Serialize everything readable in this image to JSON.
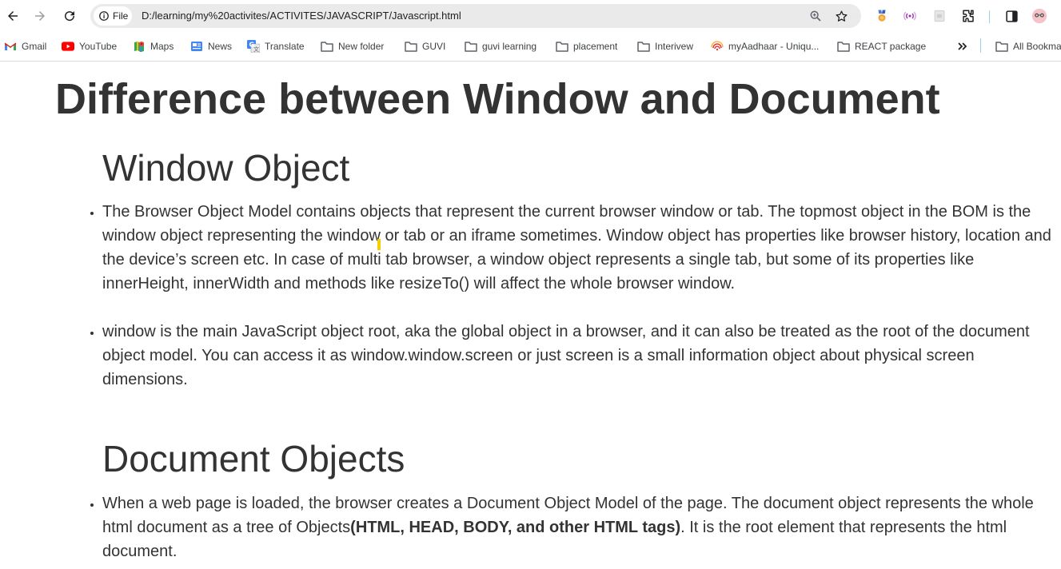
{
  "browser": {
    "site_chip": "File",
    "url": "D:/learning/my%20activites/ACTIVITES/JAVASCRIPT/Javascript.html",
    "icons": {
      "back": "back-arrow-icon",
      "forward": "forward-arrow-icon",
      "reload": "reload-icon",
      "info": "info-icon",
      "zoom": "zoom-icon",
      "bookmark": "star-icon",
      "extensions": "puzzle-icon",
      "side_panel": "side-panel-icon",
      "profile": "profile-avatar-icon"
    }
  },
  "bookmarks": [
    {
      "label": "Gmail",
      "icon": "gmail-icon"
    },
    {
      "label": "YouTube",
      "icon": "youtube-icon"
    },
    {
      "label": "Maps",
      "icon": "maps-icon"
    },
    {
      "label": "News",
      "icon": "news-icon"
    },
    {
      "label": "Translate",
      "icon": "translate-icon"
    },
    {
      "label": "New folder",
      "icon": "folder-icon"
    },
    {
      "label": "GUVI",
      "icon": "folder-icon"
    },
    {
      "label": "guvi learning",
      "icon": "folder-icon"
    },
    {
      "label": "placement",
      "icon": "folder-icon"
    },
    {
      "label": "Interivew",
      "icon": "folder-icon"
    },
    {
      "label": "myAadhaar - Uniqu...",
      "icon": "aadhaar-icon"
    },
    {
      "label": "REACT package",
      "icon": "folder-icon"
    },
    {
      "label": "All Bookma",
      "icon": "folder-icon"
    }
  ],
  "page": {
    "title": "Difference between Window and Document",
    "window_section": {
      "heading": "Window Object",
      "items": [
        "The Browser Object Model contains objects that represent the current browser window or tab. The topmost object in the BOM is the window object representing the window or tab or an iframe sometimes. Window object has properties like browser history, location and the device’s screen etc. In case of multi tab browser, a window object represents a single tab, but some of its properties like innerHeight, innerWidth and methods like resizeTo() will affect the whole browser window.",
        "window is the main JavaScript object root, aka the global object in a browser, and it can also be treated as the root of the document object model. You can access it as window.window.screen or just screen is a small information object about physical screen dimensions."
      ]
    },
    "document_section": {
      "heading": "Document Objects",
      "item_before": "When a web page is loaded, the browser creates a Document Object Model of the page. The document object represents the whole html document as a tree of Objects",
      "item_bold": "(HTML, HEAD, BODY, and other HTML tags)",
      "item_after": ". It is the root element that represents the html document."
    }
  }
}
